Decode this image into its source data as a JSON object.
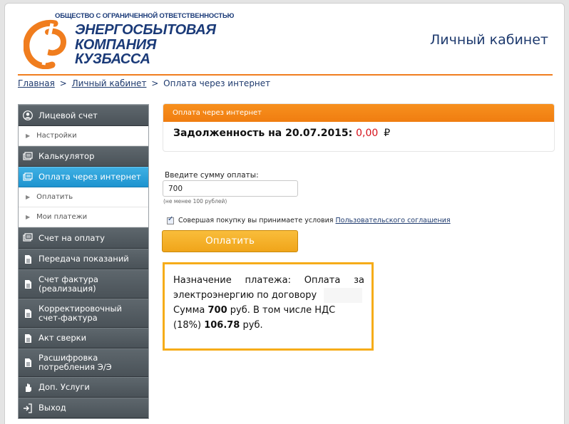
{
  "logo": {
    "small_text": "ОБЩЕСТВО С ОГРАНИЧЕННОЙ ОТВЕТСТВЕННОСТЬЮ",
    "line1": "ЭНЕРГОСБЫТОВАЯ",
    "line2": "КОМПАНИЯ",
    "line3": "КУЗБАССА"
  },
  "header": {
    "title": "Личный кабинет"
  },
  "breadcrumb": {
    "home": "Главная",
    "sep1": ">",
    "account": "Личный кабинет",
    "sep2": ">",
    "current": "Оплата через интернет"
  },
  "sidebar": {
    "items": [
      {
        "label": "Лицевой счет",
        "icon": "user-icon"
      },
      {
        "label": "Настройки",
        "sub": true
      },
      {
        "label": "Калькулятор",
        "icon": "calculator-icon"
      },
      {
        "label": "Оплата через интернет",
        "icon": "card-icon",
        "active": true
      },
      {
        "label": "Оплатить",
        "sub": true
      },
      {
        "label": "Мои платежи",
        "sub": true
      },
      {
        "label": "Счет на оплату",
        "icon": "invoice-icon"
      },
      {
        "label": "Передача показаний",
        "icon": "document-icon"
      },
      {
        "label": "Счет фактура (реализация)",
        "icon": "document-icon"
      },
      {
        "label": "Корректировочный счет-фактура",
        "icon": "document-icon"
      },
      {
        "label": "Акт сверки",
        "icon": "document-icon"
      },
      {
        "label": "Расшифровка потребления Э/Э",
        "icon": "document-icon"
      },
      {
        "label": "Доп. Услуги",
        "icon": "hand-icon"
      },
      {
        "label": "Выход",
        "icon": "exit-icon"
      }
    ]
  },
  "payment": {
    "panel_title": "Оплата через интернет",
    "debt_label": "Задолженность на 20.07.2015:",
    "debt_amount": "0,00",
    "currency": "₽",
    "sum_label": "Введите сумму оплаты:",
    "sum_value": "700",
    "sum_hint": "(не менее 100 рублей)",
    "agree_text": "Совершая покупку вы принимаете условия",
    "agree_link": "Пользовательского соглашения",
    "pay_button": "Оплатить"
  },
  "purpose": {
    "w1": "Назначение",
    "w2": "платежа:",
    "w3": "Оплата",
    "w4": "за",
    "line2": "электроэнергию по договору",
    "l3a": "Сумма",
    "l3b": "700",
    "l3c": "руб. В том числе НДС",
    "l4a": "(18%)",
    "l4b": "106.78",
    "l4c": "руб."
  },
  "colors": {
    "accent_orange": "#f07d1e",
    "active_blue": "#1d93cf",
    "debt_red": "#d6101a",
    "brand_blue": "#1a3a78"
  }
}
